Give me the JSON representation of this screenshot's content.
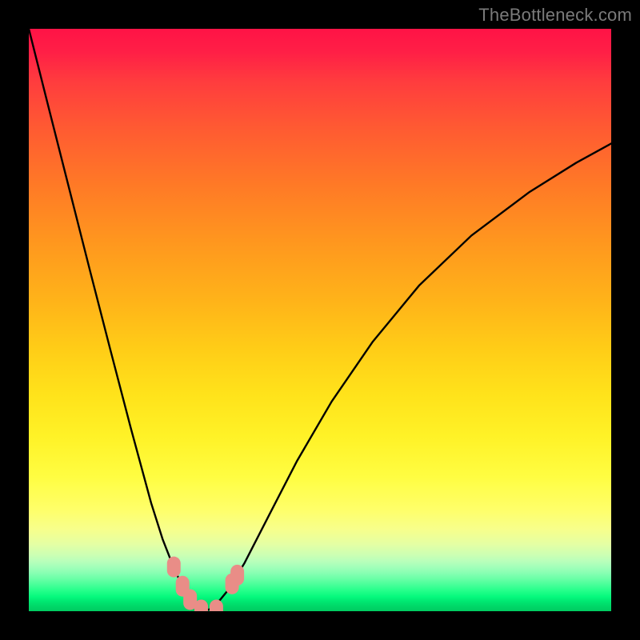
{
  "watermark": "TheBottleneck.com",
  "colors": {
    "page_background": "#000000",
    "curve_stroke": "#000000",
    "marker_fill": "#e98d87",
    "watermark_text": "#7a7a7a"
  },
  "chart_data": {
    "type": "line",
    "title": "",
    "xlabel": "",
    "ylabel": "",
    "xlim": [
      0,
      100
    ],
    "ylim": [
      0,
      100
    ],
    "grid": false,
    "legend": false,
    "note": "Values are read off the rendered pixels. x and y are expressed as percentages of the plot area (0 = left/bottom edge, 100 = right/top edge). The curve is a V / cusp shape touching y=0 near x≈29.",
    "series": [
      {
        "name": "bottleneck-curve",
        "x": [
          0.0,
          3.5,
          7.0,
          10.5,
          14.0,
          17.5,
          21.0,
          23.0,
          24.8,
          26.2,
          27.4,
          28.4,
          29.2,
          30.0,
          31.0,
          32.4,
          34.2,
          37.0,
          41.0,
          46.0,
          52.0,
          59.0,
          67.0,
          76.0,
          86.0,
          94.0,
          100.0
        ],
        "y": [
          100.0,
          86.1,
          72.3,
          58.5,
          44.9,
          31.5,
          18.6,
          12.3,
          7.7,
          4.6,
          2.4,
          1.0,
          0.2,
          0.0,
          0.3,
          1.4,
          3.6,
          8.2,
          16.0,
          25.7,
          36.0,
          46.2,
          55.9,
          64.5,
          72.0,
          77.0,
          80.3
        ]
      }
    ],
    "markers": {
      "name": "highlighted-point-cluster",
      "shape": "rounded-capsule",
      "color": "#e98d87",
      "points": [
        {
          "x": 24.9,
          "y": 7.6
        },
        {
          "x": 26.4,
          "y": 4.3
        },
        {
          "x": 27.7,
          "y": 2.0
        },
        {
          "x": 29.6,
          "y": 0.2
        },
        {
          "x": 32.2,
          "y": 0.2
        },
        {
          "x": 34.9,
          "y": 4.7
        },
        {
          "x": 35.8,
          "y": 6.2
        }
      ]
    }
  }
}
